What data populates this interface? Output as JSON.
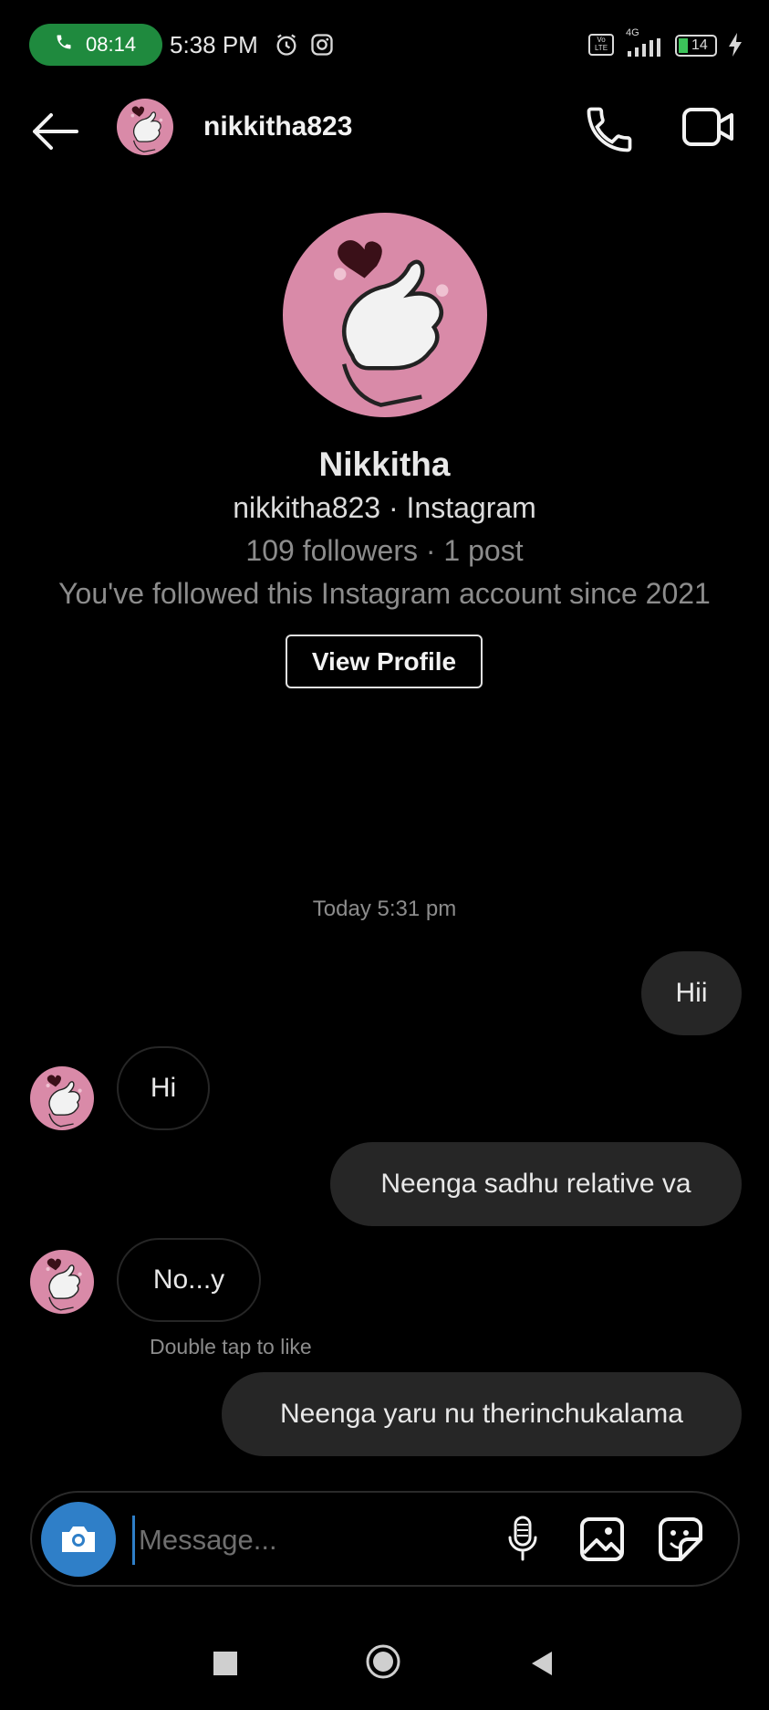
{
  "status_bar": {
    "call_timer": "08:14",
    "time": "5:38 PM",
    "battery": "14",
    "network": "4G",
    "volte": "Vo LTE"
  },
  "header": {
    "username": "nikkitha823"
  },
  "profile": {
    "name": "Nikkitha",
    "handle": "nikkitha823 · Instagram",
    "stats": "109 followers · 1 post",
    "follow_since": "You've followed this Instagram account since 2021",
    "view_profile_label": "View Profile"
  },
  "thread": {
    "timestamp": "Today 5:31 pm",
    "messages": [
      {
        "direction": "outgoing",
        "text": "Hii"
      },
      {
        "direction": "incoming",
        "text": "Hi"
      },
      {
        "direction": "outgoing",
        "text": "Neenga sadhu relative va"
      },
      {
        "direction": "incoming",
        "text": "No...y"
      },
      {
        "direction": "outgoing",
        "text": "Neenga yaru nu therinchukalama"
      }
    ],
    "like_hint": "Double tap to like"
  },
  "composer": {
    "placeholder": "Message..."
  },
  "colors": {
    "background": "#000000",
    "bubble_outgoing": "#262626",
    "camera_button": "#2f7fc8",
    "call_pill": "#1f8a3e",
    "avatar_pink": "#d98aa8"
  }
}
